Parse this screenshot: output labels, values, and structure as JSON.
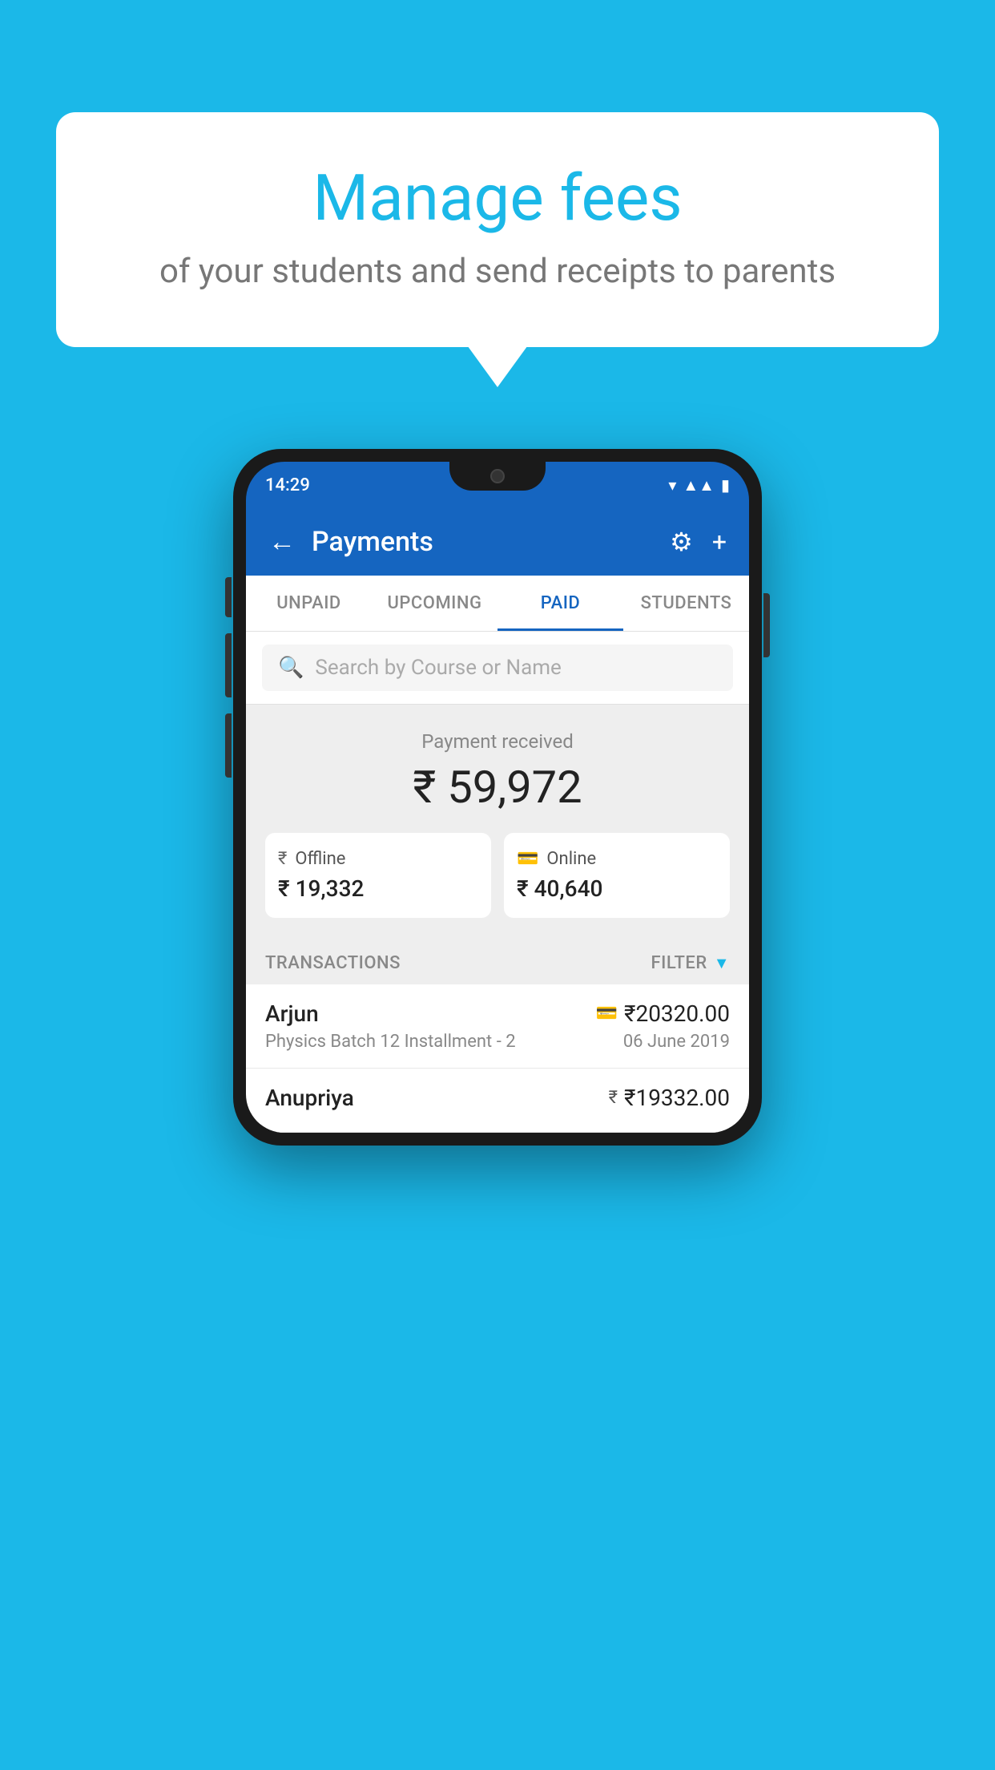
{
  "background": {
    "color": "#1BB8E8"
  },
  "speech_bubble": {
    "title": "Manage fees",
    "subtitle": "of your students and send receipts to parents"
  },
  "phone": {
    "status_bar": {
      "time": "14:29"
    },
    "header": {
      "title": "Payments",
      "back_label": "←",
      "gear_label": "⚙",
      "plus_label": "+"
    },
    "tabs": [
      {
        "label": "UNPAID",
        "active": false
      },
      {
        "label": "UPCOMING",
        "active": false
      },
      {
        "label": "PAID",
        "active": true
      },
      {
        "label": "STUDENTS",
        "active": false
      }
    ],
    "search": {
      "placeholder": "Search by Course or Name"
    },
    "payment_summary": {
      "received_label": "Payment received",
      "total_amount": "₹ 59,972",
      "offline_label": "Offline",
      "offline_amount": "₹ 19,332",
      "online_label": "Online",
      "online_amount": "₹ 40,640"
    },
    "transactions": {
      "header_label": "TRANSACTIONS",
      "filter_label": "FILTER",
      "items": [
        {
          "name": "Arjun",
          "amount": "₹20320.00",
          "course": "Physics Batch 12 Installment - 2",
          "date": "06 June 2019",
          "payment_type": "online"
        },
        {
          "name": "Anupriya",
          "amount": "₹19332.00",
          "course": "",
          "date": "",
          "payment_type": "offline"
        }
      ]
    }
  }
}
